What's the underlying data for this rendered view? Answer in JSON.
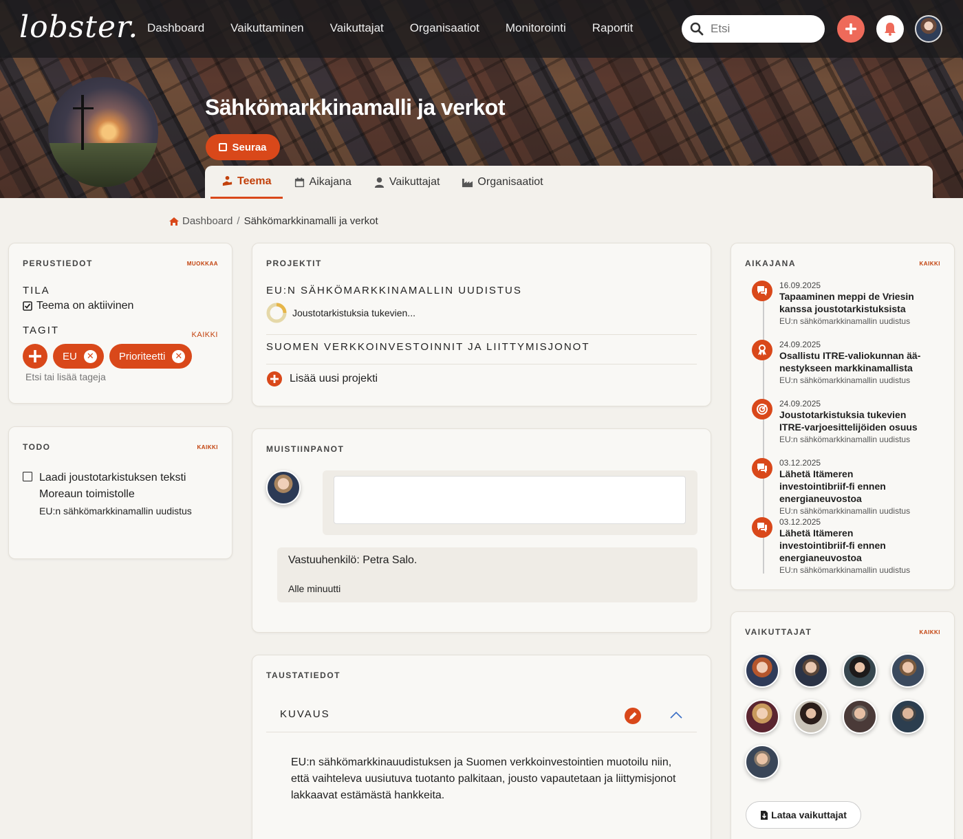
{
  "nav": {
    "logo": "lobster.",
    "links": [
      "Dashboard",
      "Vaikuttaminen",
      "Vaikuttajat",
      "Organisaatiot",
      "Monitorointi",
      "Raportit"
    ],
    "search_placeholder": "Etsi"
  },
  "hero": {
    "title": "Sähkömarkkinamalli ja verkot",
    "follow_label": "Seuraa",
    "tabs": [
      {
        "label": "Teema",
        "icon": "theme-icon",
        "active": true
      },
      {
        "label": "Aikajana",
        "icon": "calendar-icon",
        "active": false
      },
      {
        "label": "Vaikuttajat",
        "icon": "person-icon",
        "active": false
      },
      {
        "label": "Organisaatiot",
        "icon": "factory-icon",
        "active": false
      }
    ]
  },
  "breadcrumb": {
    "home": "Dashboard",
    "current": "Sähkömarkkinamalli ja verkot"
  },
  "basics": {
    "title": "PERUSTIEDOT",
    "edit": "MUOKKAA",
    "status_heading": "TILA",
    "status_value": "Teema on aktiivinen",
    "tags_heading": "TAGIT",
    "tags_link": "KAIKKI",
    "tags": [
      "EU",
      "Prioriteetti"
    ],
    "tag_search_placeholder": "Etsi tai lisää tageja"
  },
  "todo": {
    "title": "TODO",
    "link": "KAIKKI",
    "items": [
      {
        "text": "Laadi joustotarkistuksen teksti Moreaun toimistolle",
        "project": "EU:n sähkömarkkinamallin uudistus"
      }
    ]
  },
  "projects": {
    "title": "PROJEKTIT",
    "items": [
      {
        "name": "EU:N SÄHKÖMARKKINAMALLIN UUDISTUS",
        "task": "Joustotarkistuksia tukevien..."
      },
      {
        "name": "SUOMEN VERKKOINVESTOINNIT JA LIITTYMISJONOT",
        "task": ""
      }
    ],
    "add_label": "Lisää uusi projekti"
  },
  "notes": {
    "title": "MUISTIINPANOT",
    "entries": [
      {
        "text": "Vastuuhenkilö: Petra Salo.",
        "meta": "Alle minuutti"
      }
    ]
  },
  "background": {
    "title": "TAUSTATIEDOT",
    "section": "KUVAUS",
    "description": "EU:n sähkömarkkinauudistuksen ja Suomen verkkoinvestointien muotoilu niin, että vaihteleva uusiutuva tuotanto palkitaan, jousto vapautetaan ja liittymisjonot lakkaavat estämästä hankkeita."
  },
  "timeline": {
    "title": "AIKAJANA",
    "link": "KAIKKI",
    "items": [
      {
        "date": "16.09.2025",
        "title": "Tapaaminen meppi de Vriesin kanssa joustotarkistuksista",
        "project": "EU:n sähkömarkkinamallin uudistus",
        "icon": "chat-icon"
      },
      {
        "date": "24.09.2025",
        "title": "Osallistu ITRE-valiokunnan ää-nestykseen markkinamallista",
        "project": "EU:n sähkömarkkinamallin uudistus",
        "icon": "ribbon-icon"
      },
      {
        "date": "24.09.2025",
        "title": "Joustotarkistuksia tukevien ITRE-varjoesittelijöiden osuus",
        "project": "EU:n sähkömarkkinamallin uudistus",
        "icon": "target-icon"
      },
      {
        "date": "03.12.2025",
        "title": "Lähetä Itämeren investointibriif-fi ennen energianeuvostoa",
        "project": "EU:n sähkömarkkinamallin uudistus",
        "icon": "chat-icon"
      },
      {
        "date": "03.12.2025",
        "title": "Lähetä Itämeren investointibriif-fi ennen energianeuvostoa",
        "project": "EU:n sähkömarkkinamallin uudistus",
        "icon": "chat-icon"
      }
    ]
  },
  "influencers": {
    "title": "VAIKUTTAJAT",
    "link": "KAIKKI",
    "download_label": "Lataa vaikuttajat",
    "count": 9
  },
  "colors": {
    "accent": "#d9481a",
    "background": "#f3f1ec",
    "card": "#f9f8f5"
  }
}
